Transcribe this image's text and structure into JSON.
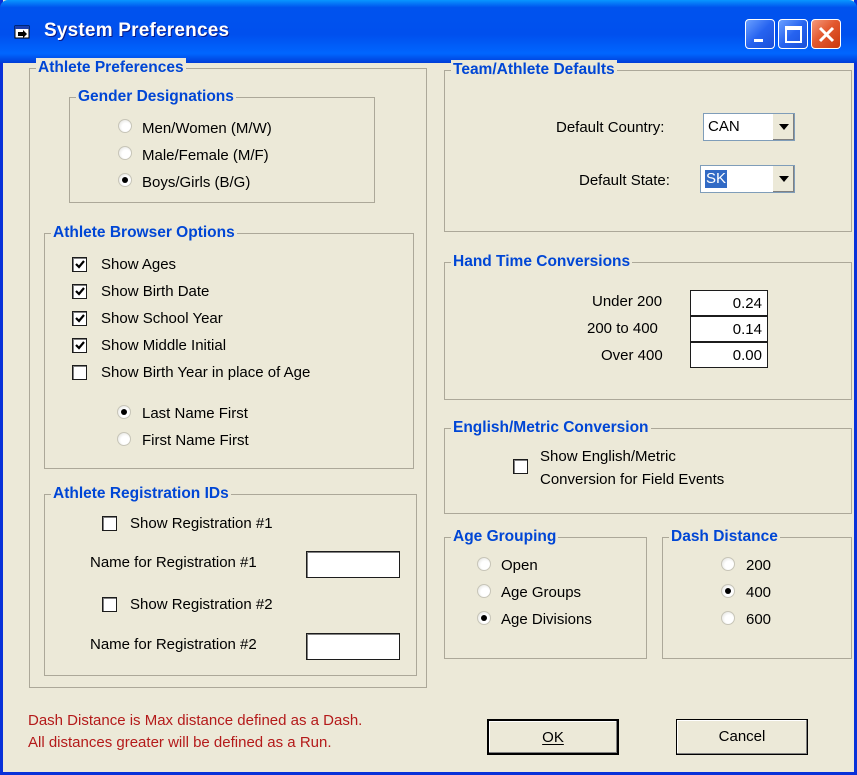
{
  "window": {
    "title": "System Preferences"
  },
  "athlete_prefs": {
    "title": "Athlete Preferences",
    "gender": {
      "title": "Gender Designations",
      "options": [
        {
          "label": "Men/Women (M/W)",
          "selected": false
        },
        {
          "label": "Male/Female (M/F)",
          "selected": false
        },
        {
          "label": "Boys/Girls (B/G)",
          "selected": true
        }
      ]
    }
  },
  "browser": {
    "title": "Athlete Browser Options",
    "checks": [
      {
        "label": "Show Ages",
        "checked": true
      },
      {
        "label": "Show Birth Date",
        "checked": true
      },
      {
        "label": "Show School Year",
        "checked": true
      },
      {
        "label": "Show Middle Initial",
        "checked": true
      },
      {
        "label": "Show Birth Year in place of Age",
        "checked": false
      }
    ],
    "name_order": [
      {
        "label": "Last Name First",
        "selected": true
      },
      {
        "label": "First Name First",
        "selected": false
      }
    ]
  },
  "registration": {
    "title": "Athlete Registration IDs",
    "show1": {
      "label": "Show Registration #1",
      "checked": false
    },
    "name1": {
      "label": "Name for Registration #1",
      "value": ""
    },
    "show2": {
      "label": "Show Registration #2",
      "checked": false
    },
    "name2": {
      "label": "Name for Registration #2",
      "value": ""
    }
  },
  "defaults": {
    "title": "Team/Athlete Defaults",
    "country": {
      "label": "Default Country:",
      "value": "CAN"
    },
    "state": {
      "label": "Default State:",
      "value": "SK"
    }
  },
  "hand_time": {
    "title": "Hand Time Conversions",
    "rows": [
      {
        "label": "Under 200",
        "value": "0.24"
      },
      {
        "label": "200 to 400",
        "value": "0.14"
      },
      {
        "label": "Over 400",
        "value": "0.00"
      }
    ]
  },
  "metric": {
    "title": "English/Metric Conversion",
    "line1": "Show English/Metric",
    "line2": "Conversion for Field Events",
    "checked": false
  },
  "age_grouping": {
    "title": "Age Grouping",
    "options": [
      {
        "label": "Open",
        "selected": false
      },
      {
        "label": "Age Groups",
        "selected": false
      },
      {
        "label": "Age Divisions",
        "selected": true
      }
    ]
  },
  "dash": {
    "title": "Dash Distance",
    "options": [
      {
        "label": "200",
        "selected": false
      },
      {
        "label": "400",
        "selected": true
      },
      {
        "label": "600",
        "selected": false
      }
    ]
  },
  "note": {
    "line1": "Dash Distance is Max distance defined as a Dash.",
    "line2": "All distances greater will be defined as a Run."
  },
  "buttons": {
    "ok": "OK",
    "cancel": "Cancel"
  },
  "colors": {
    "title_bar": "#0054e3",
    "group_title": "#0046d5",
    "note_text": "#b41a1a",
    "dialog_bg": "#ece9d8"
  }
}
